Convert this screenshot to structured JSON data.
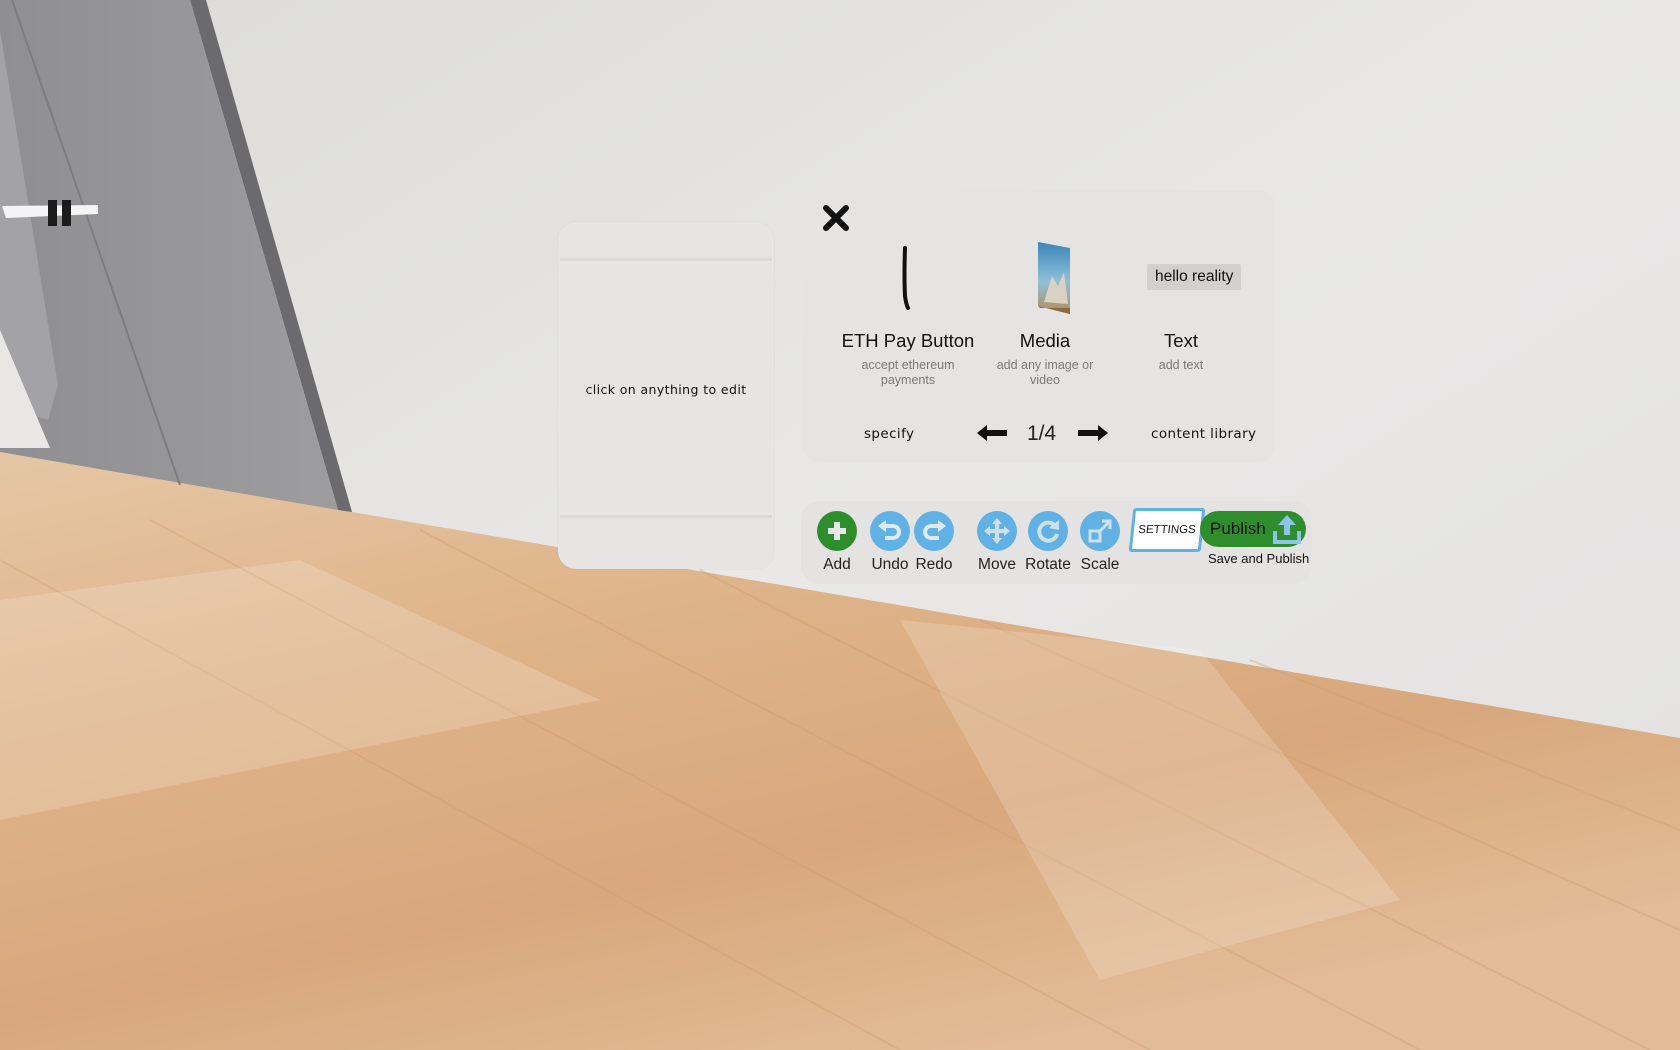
{
  "edit_panel": {
    "hint": "click on anything to edit"
  },
  "add_menu": {
    "items": [
      {
        "title": "ETH Pay Button",
        "desc": "accept ethereum payments",
        "preview": "pay-button-preview"
      },
      {
        "title": "Media",
        "desc": "add any image or video",
        "preview": "media-thumbnail"
      },
      {
        "title": "Text",
        "desc": "add text",
        "preview": "hello reality"
      }
    ],
    "specify_label": "specify",
    "page_indicator": "1/4",
    "content_library_label": "content library"
  },
  "toolbar": {
    "add": "Add",
    "undo": "Undo",
    "redo": "Redo",
    "move": "Move",
    "rotate": "Rotate",
    "scale": "Scale",
    "settings": "SETTINGS",
    "publish": "Publish",
    "publish_sub": "Save and Publish"
  },
  "colors": {
    "green_accent": "#2f8e2c",
    "blue_accent": "#5fb1e6",
    "panel_bg": "#e5e4e3"
  }
}
